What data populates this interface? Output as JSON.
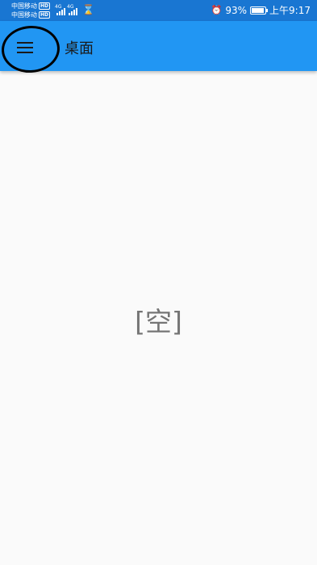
{
  "status_bar": {
    "carriers": [
      "中国移动",
      "中国移动"
    ],
    "hd_badge": "HD",
    "network_type": "4G",
    "battery_percent": "93%",
    "battery_level": 0.93,
    "time": "上午9:17",
    "alarm_icon": "⏰",
    "hourglass_icon": "⌛"
  },
  "app_bar": {
    "title": "桌面",
    "menu_icon": "menu-icon",
    "color": "#2196f3"
  },
  "main": {
    "empty_text": "[空]"
  }
}
